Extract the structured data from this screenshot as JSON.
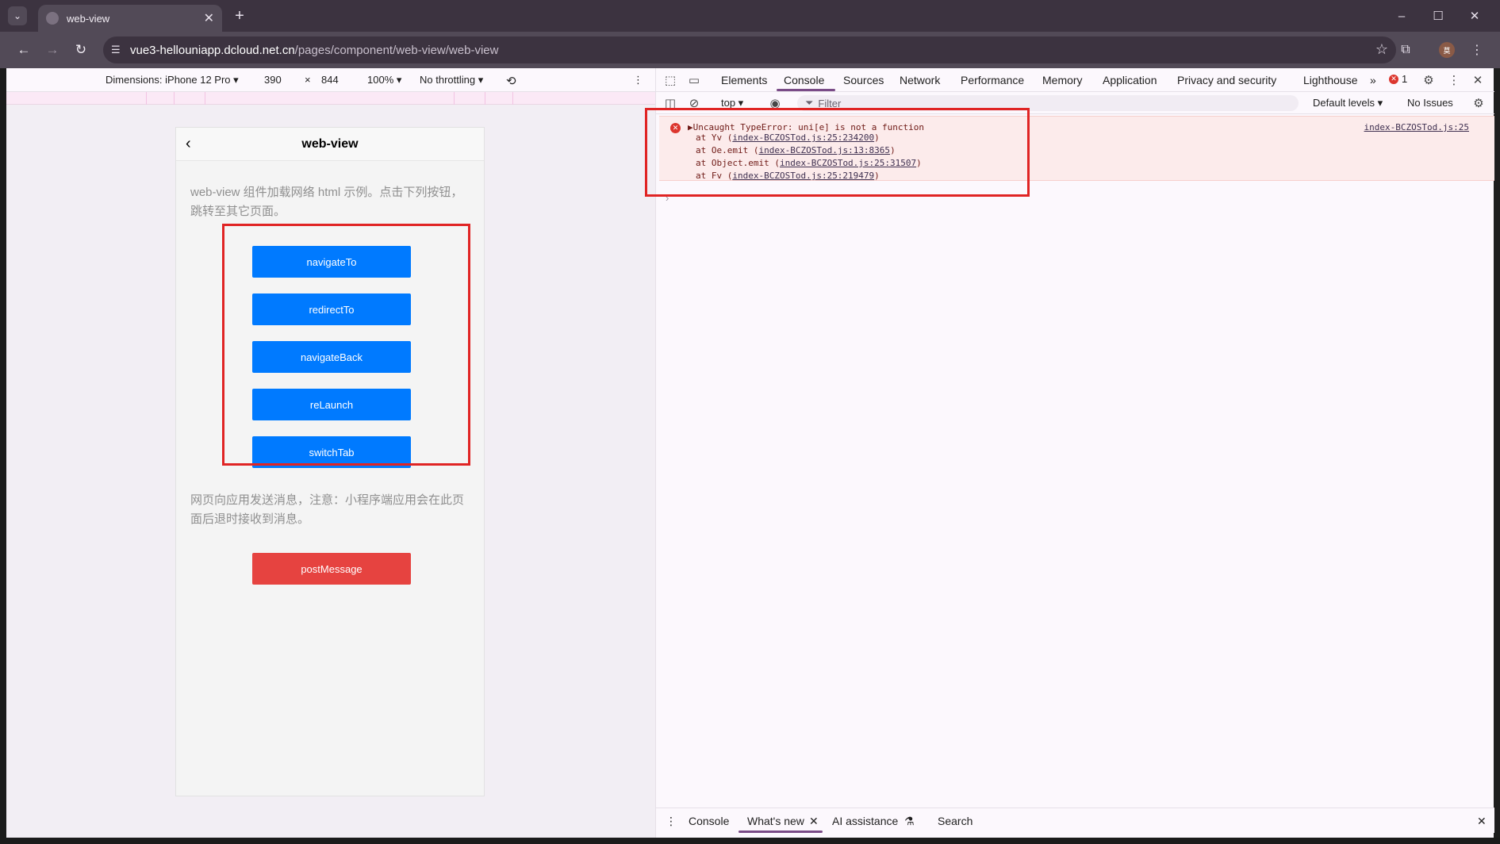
{
  "browser": {
    "tab_title": "web-view",
    "url_host": "vue3-hellouniapp.dcloud.net.cn",
    "url_path": "/pages/component/web-view/web-view",
    "tab_close_glyph": "✕",
    "new_tab_glyph": "+",
    "tab_list_glyph": "⌄",
    "window_controls": [
      "–",
      "☐",
      "✕"
    ],
    "nav": {
      "back": "←",
      "forward": "→",
      "reload": "↻"
    },
    "profile_initial": "莫"
  },
  "device_toolbar": {
    "dimensions_label": "Dimensions: iPhone 12 Pro ▾",
    "width": "390",
    "times": "×",
    "height": "844",
    "zoom": "100% ▾",
    "throttling": "No throttling ▾",
    "more": "⋮"
  },
  "page": {
    "nav_title": "web-view",
    "back_glyph": "‹",
    "description_1": "web-view 组件加载网络 html 示例。点击下列按钮，跳转至其它页面。",
    "buttons": [
      "navigateTo",
      "redirectTo",
      "navigateBack",
      "reLaunch",
      "switchTab"
    ],
    "description_2": "网页向应用发送消息，注意：小程序端应用会在此页面后退时接收到消息。",
    "post_button": "postMessage"
  },
  "devtools": {
    "tabs": [
      "Elements",
      "Console",
      "Sources",
      "Network",
      "Performance",
      "Memory",
      "Application",
      "Privacy and security",
      "Lighthouse"
    ],
    "more_tabs": "»",
    "error_count": "1",
    "console_toolbar": {
      "context": "top ▾",
      "filter_placeholder": "Filter",
      "levels": "Default levels ▾",
      "issues": "No Issues"
    },
    "error": {
      "message": "▶Uncaught TypeError: uni[e] is not a function",
      "source": "index-BCZOSTod.js:25",
      "frames": [
        {
          "prefix": "at Yv (",
          "link": "index-BCZOSTod.js:25:234200",
          "suffix": ")"
        },
        {
          "prefix": "at Oe.emit (",
          "link": "index-BCZOSTod.js:13:8365",
          "suffix": ")"
        },
        {
          "prefix": "at Object.emit (",
          "link": "index-BCZOSTod.js:25:31507",
          "suffix": ")"
        },
        {
          "prefix": "at Fv (",
          "link": "index-BCZOSTod.js:25:219479",
          "suffix": ")"
        }
      ]
    },
    "prompt": "›",
    "drawer_tabs": [
      "Console",
      "What's new",
      "AI assistance",
      "Search"
    ],
    "drawer_close": "✕"
  },
  "colors": {
    "primary_button": "#007aff",
    "warn_button": "#e64340",
    "annotation": "#e02424",
    "devtools_accent": "#7a4b87"
  }
}
